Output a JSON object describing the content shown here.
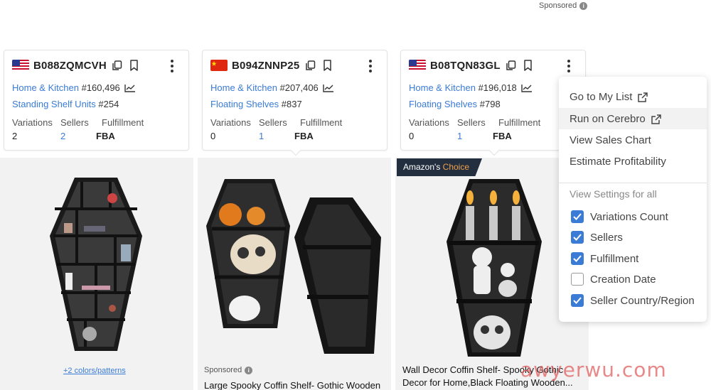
{
  "sponsored_label": "Sponsored",
  "cards": [
    {
      "flag": "US",
      "asin": "B088ZQMCVH",
      "main_category": "Home & Kitchen",
      "main_rank": "#160,496",
      "sub_category": "Standing Shelf Units",
      "sub_rank": "#254",
      "stats": {
        "labels": [
          "Variations",
          "Sellers",
          "Fulfillment"
        ],
        "variations": "2",
        "sellers": "2",
        "fulfillment": "FBA"
      }
    },
    {
      "flag": "CN",
      "asin": "B094ZNNP25",
      "main_category": "Home & Kitchen",
      "main_rank": "#207,406",
      "sub_category": "Floating Shelves",
      "sub_rank": "#837",
      "stats": {
        "labels": [
          "Variations",
          "Sellers",
          "Fulfillment"
        ],
        "variations": "0",
        "sellers": "1",
        "fulfillment": "FBA"
      }
    },
    {
      "flag": "US",
      "asin": "B08TQN83GL",
      "main_category": "Home & Kitchen",
      "main_rank": "#196,018",
      "sub_category": "Floating Shelves",
      "sub_rank": "#798",
      "stats": {
        "labels": [
          "Variations",
          "Sellers",
          "Fulfillment"
        ],
        "variations": "0",
        "sellers": "1",
        "fulfillment": "FBA"
      }
    }
  ],
  "badge": {
    "brand": "Amazon's",
    "word": "Choice"
  },
  "products": {
    "p1_colors_link": "+2 colors/patterns",
    "p2_sponsored": "Sponsored",
    "p2_title": "Large Spooky Coffin Shelf- Gothic Wooden",
    "p3_title_line1": "Wall Decor Coffin Shelf- Spooky Gothic",
    "p3_title_line2": "Decor for Home,Black Floating Wooden..."
  },
  "menu": {
    "items": [
      "Go to My List",
      "Run on Cerebro",
      "View Sales Chart",
      "Estimate Profitability"
    ],
    "section_title": "View Settings for all",
    "settings": [
      {
        "label": "Variations Count",
        "checked": true
      },
      {
        "label": "Sellers",
        "checked": true
      },
      {
        "label": "Fulfillment",
        "checked": true
      },
      {
        "label": "Creation Date",
        "checked": false
      },
      {
        "label": "Seller Country/Region",
        "checked": true
      }
    ]
  },
  "watermark": "awyerwu.com",
  "colors": {
    "link_blue": "#3a7bd5",
    "badge_bg": "#232f3e",
    "badge_accent": "#f0a14b",
    "checkbox_blue": "#3a7bd5"
  }
}
